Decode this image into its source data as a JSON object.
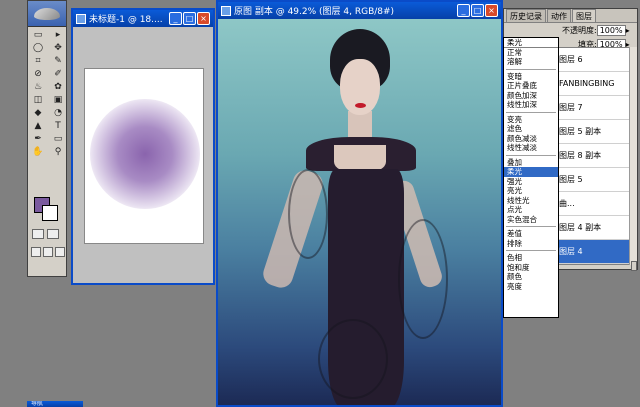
{
  "toolbox": {
    "tools": [
      "▭",
      "▸",
      "◯",
      "✥",
      "⌗",
      "✎",
      "⊘",
      "✐",
      "♨",
      "✿",
      "◫",
      "▣",
      "◆",
      "◔",
      "▲",
      "T",
      "✒",
      "▭",
      "✋",
      "⚲"
    ],
    "foreground_color": "#7a5a9e",
    "background_color": "#ffffff"
  },
  "untitled_window": {
    "title": "未标题-1 @ 18...."
  },
  "main_window": {
    "title": "原图 副本 @ 49.2% (图层 4, RGB/8#)"
  },
  "palette": {
    "tabs": [
      "历史记录",
      "动作",
      "图层"
    ],
    "blend_mode": "柔光",
    "opacity_label": "不透明度:",
    "opacity_value": "100%",
    "fill_label": "填充:",
    "fill_value": "100%",
    "layers": [
      "图层 6",
      "FANBINGBING",
      "图层 7",
      "图层 5 副本",
      "图层 8 副本",
      "图层 5",
      "曲...",
      "图层 4 副本",
      "图层 4"
    ],
    "selected_layer_index": 8
  },
  "blend_dropdown": {
    "groups": [
      [
        "正常",
        "溶解"
      ],
      [
        "变暗",
        "正片叠底",
        "颜色加深",
        "线性加深"
      ],
      [
        "变亮",
        "滤色",
        "颜色减淡",
        "线性减淡"
      ],
      [
        "叠加",
        "柔光",
        "强光",
        "亮光",
        "线性光",
        "点光",
        "实色混合"
      ],
      [
        "差值",
        "排除"
      ],
      [
        "色相",
        "饱和度",
        "颜色",
        "亮度"
      ]
    ],
    "selected": "柔光"
  },
  "bottom_palette": {
    "title": "导航"
  }
}
